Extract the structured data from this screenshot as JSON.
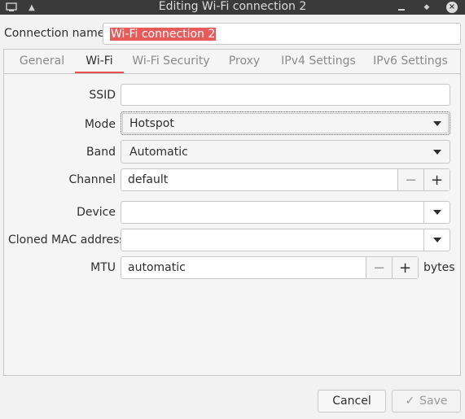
{
  "window": {
    "title": "Editing Wi-Fi connection 2"
  },
  "connection_name": {
    "label": "Connection name",
    "value": "Wi-Fi connection 2"
  },
  "tabs": [
    {
      "label": "General"
    },
    {
      "label": "Wi-Fi"
    },
    {
      "label": "Wi-Fi Security"
    },
    {
      "label": "Proxy"
    },
    {
      "label": "IPv4 Settings"
    },
    {
      "label": "IPv6 Settings"
    }
  ],
  "active_tab": "Wi-Fi",
  "wifi": {
    "ssid": {
      "label": "SSID",
      "value": ""
    },
    "mode": {
      "label": "Mode",
      "value": "Hotspot"
    },
    "band": {
      "label": "Band",
      "value": "Automatic"
    },
    "channel": {
      "label": "Channel",
      "value": "default"
    },
    "device": {
      "label": "Device",
      "value": ""
    },
    "cloned_mac": {
      "label": "Cloned MAC address",
      "value": ""
    },
    "mtu": {
      "label": "MTU",
      "value": "automatic",
      "unit": "bytes"
    }
  },
  "buttons": {
    "cancel": "Cancel",
    "save": "Save"
  },
  "colors": {
    "accent": "#e8524d",
    "selection": "#e85b5b",
    "titlebar": "#3a3a3a"
  }
}
